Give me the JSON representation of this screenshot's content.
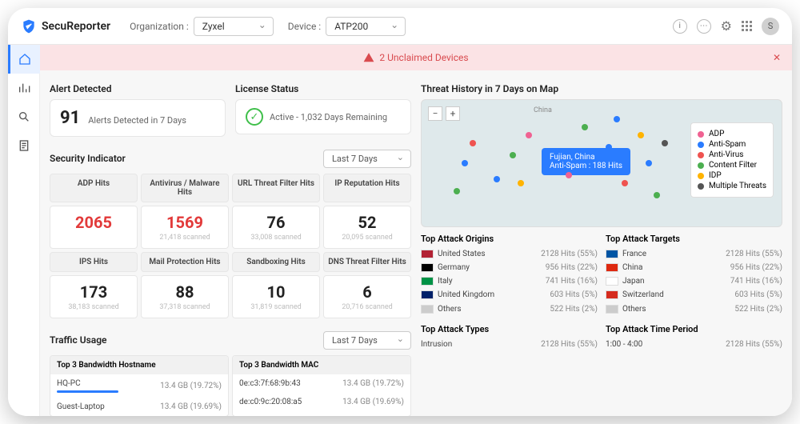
{
  "brand": "SecuReporter",
  "org_label": "Organization :",
  "org_value": "Zyxel",
  "device_label": "Device :",
  "device_value": "ATP200",
  "avatar_letter": "S",
  "alert_banner": "2 Unclaimed Devices",
  "alerts": {
    "title": "Alert Detected",
    "count": "91",
    "caption": "Alerts Detected in 7 Days"
  },
  "license": {
    "title": "License Status",
    "status": "Active - 1,032 Days Remaining"
  },
  "security": {
    "title": "Security Indicator",
    "period": "Last 7 Days",
    "headers": [
      "ADP Hits",
      "Antivirus / Malware Hits",
      "URL Threat Filter Hits",
      "IP Reputation Hits",
      "IPS Hits",
      "Mail Protection Hits",
      "Sandboxing Hits",
      "DNS Threat Filter Hits"
    ],
    "values": [
      "2065",
      "1569",
      "76",
      "52",
      "173",
      "88",
      "10",
      "6"
    ],
    "scans": [
      "",
      "21,418 scanned",
      "33,008 scanned",
      "20,095 scanned",
      "38,183 scanned",
      "37,318 scanned",
      "31,819 scanned",
      "20,716 scanned"
    ]
  },
  "traffic": {
    "title": "Traffic Usage",
    "period": "Last 7 Days",
    "col1_title": "Top 3 Bandwidth Hostname",
    "col2_title": "Top 3 Bandwidth MAC",
    "hosts": [
      {
        "name": "HQ-PC",
        "val": "13.4 GB (19.72%)"
      },
      {
        "name": "Guest-Laptop",
        "val": "13.4 GB (19.69%)"
      }
    ],
    "macs": [
      {
        "name": "0e:c3:7f:68:9b:43",
        "val": "13.4 GB (19.72%)"
      },
      {
        "name": "de:c0:9c:20:08:a5",
        "val": "13.4 GB (19.69%)"
      }
    ]
  },
  "map": {
    "title": "Threat History in 7 Days on Map",
    "location_label": "China",
    "tooltip_place": "Fujian, China",
    "tooltip_stat": "Anti-Spam : 188 Hits",
    "legend": [
      {
        "color": "#f06292",
        "label": "ADP"
      },
      {
        "color": "#2a7cff",
        "label": "Anti-Spam"
      },
      {
        "color": "#ef5350",
        "label": "Anti-Virus"
      },
      {
        "color": "#4caf50",
        "label": "Content Filter"
      },
      {
        "color": "#ffb300",
        "label": "IDP"
      },
      {
        "color": "#555",
        "label": "Multiple Threats"
      }
    ]
  },
  "origins_title": "Top Attack Origins",
  "targets_title": "Top Attack Targets",
  "origins": [
    {
      "flag": "#b22234",
      "name": "United States",
      "val": "2128 Hits (55%)"
    },
    {
      "flag": "#000",
      "name": "Germany",
      "val": "956 Hits (22%)"
    },
    {
      "flag": "#009246",
      "name": "Italy",
      "val": "741 Hits (16%)"
    },
    {
      "flag": "#012169",
      "name": "United Kingdom",
      "val": "603 Hits (5%)"
    },
    {
      "flag": "#ccc",
      "name": "Others",
      "val": "522 Hits (2%)"
    }
  ],
  "targets": [
    {
      "flag": "#0055a4",
      "name": "France",
      "val": "2128 Hits (55%)"
    },
    {
      "flag": "#de2910",
      "name": "China",
      "val": "956 Hits (22%)"
    },
    {
      "flag": "#fff",
      "name": "Japan",
      "val": "741 Hits (16%)"
    },
    {
      "flag": "#d52b1e",
      "name": "Switzerland",
      "val": "603 Hits (5%)"
    },
    {
      "flag": "#ccc",
      "name": "Others",
      "val": "522 Hits (2%)"
    }
  ],
  "types_title": "Top Attack Types",
  "times_title": "Top Attack Time Period",
  "types": [
    {
      "name": "Intrusion",
      "val": "2128 Hits (55%)"
    }
  ],
  "times": [
    {
      "name": "1:00 - 4:00",
      "val": "2128 Hits (55%)"
    }
  ]
}
